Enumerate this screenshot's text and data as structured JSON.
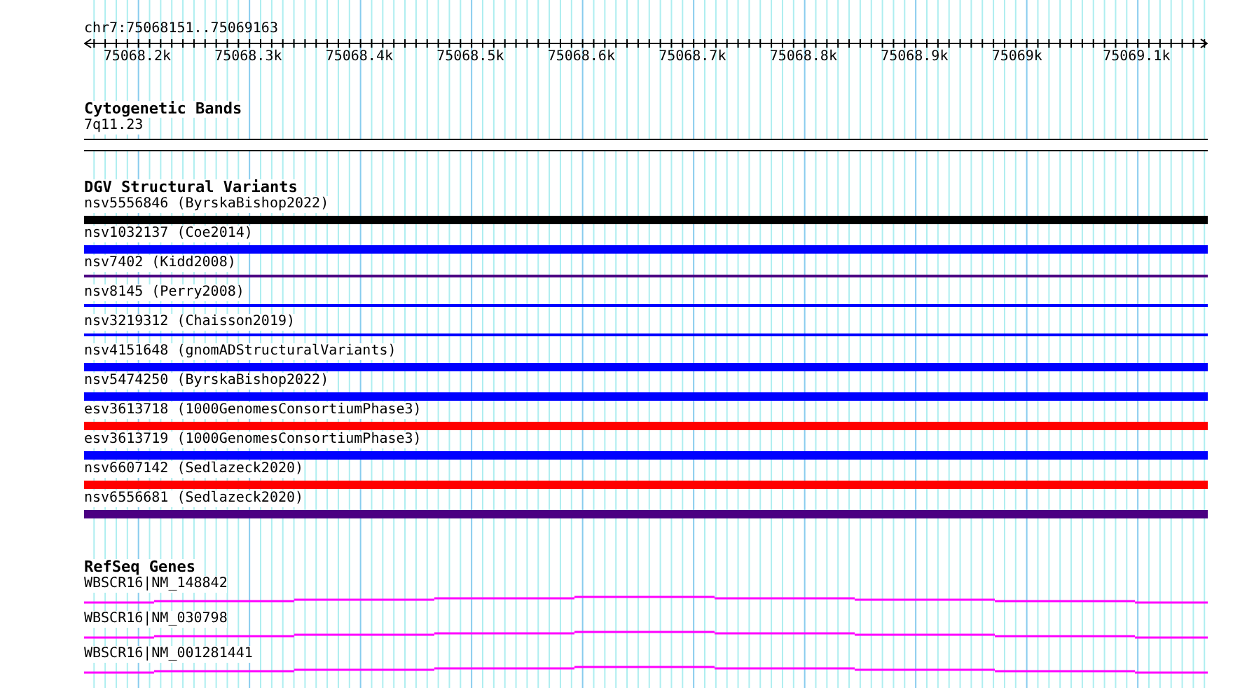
{
  "ruler": {
    "location": "chr7:75068151..75069163",
    "tick_labels": [
      "75068.2k",
      "75068.3k",
      "75068.4k",
      "75068.5k",
      "75068.6k",
      "75068.7k",
      "75068.8k",
      "75068.9k",
      "75069k",
      "75069.1k"
    ]
  },
  "tracks": [
    {
      "kind": "bands",
      "title": "Cytogenetic Bands",
      "features": [
        {
          "label": "7q11.23"
        }
      ]
    },
    {
      "kind": "variants",
      "title": "DGV Structural Variants",
      "features": [
        {
          "label": "nsv5556846 (ByrskaBishop2022)",
          "kind": "thick",
          "color": "#000000"
        },
        {
          "label": "nsv1032137 (Coe2014)",
          "kind": "thick",
          "color": "#0000ff"
        },
        {
          "label": "nsv7402 (Kidd2008)",
          "kind": "thin",
          "color": "#4b0082"
        },
        {
          "label": "nsv8145 (Perry2008)",
          "kind": "thin",
          "color": "#0000ff"
        },
        {
          "label": "nsv3219312 (Chaisson2019)",
          "kind": "thin",
          "color": "#0000ff"
        },
        {
          "label": "nsv4151648 (gnomADStructuralVariants)",
          "kind": "thick",
          "color": "#0000ff"
        },
        {
          "label": "nsv5474250 (ByrskaBishop2022)",
          "kind": "thick",
          "color": "#0000ff"
        },
        {
          "label": "esv3613718 (1000GenomesConsortiumPhase3)",
          "kind": "thick",
          "color": "#ff0000"
        },
        {
          "label": "esv3613719 (1000GenomesConsortiumPhase3)",
          "kind": "thick",
          "color": "#0000ff"
        },
        {
          "label": "nsv6607142 (Sedlazeck2020)",
          "kind": "thick",
          "color": "#ff0000"
        },
        {
          "label": "nsv6556681 (Sedlazeck2020)",
          "kind": "thick",
          "color": "#4b0082"
        }
      ]
    },
    {
      "kind": "genes",
      "title": "RefSeq Genes",
      "features": [
        {
          "label": "WBSCR16|NM_148842"
        },
        {
          "label": "WBSCR16|NM_030798"
        },
        {
          "label": "WBSCR16|NM_001281441"
        }
      ]
    }
  ]
}
